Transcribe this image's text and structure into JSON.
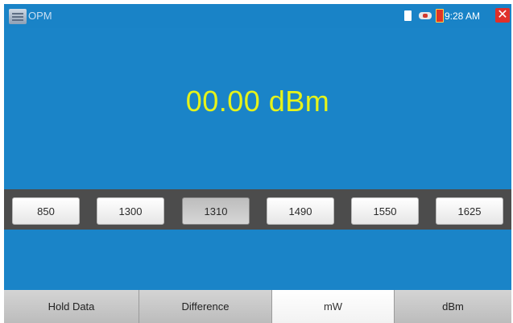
{
  "app": {
    "title": "OPM",
    "app_icon": "menu-list-icon"
  },
  "status": {
    "time": "9:28 AM",
    "icons": [
      "sim-card-icon",
      "usb-connection-icon",
      "battery-charging-icon"
    ],
    "close_glyph": "✕"
  },
  "meter": {
    "reading": "00.00 dBm",
    "reading_color": "#e6f31a"
  },
  "wavelengths": {
    "items": [
      "850",
      "1300",
      "1310",
      "1490",
      "1550",
      "1625"
    ],
    "selected": "1310"
  },
  "functions": {
    "hold_data": "Hold Data",
    "difference": "Difference",
    "mw": "mW",
    "dbm": "dBm",
    "active": "mW"
  },
  "colors": {
    "background": "#1a84c8",
    "reading": "#e6f31a",
    "close": "#e0302a"
  }
}
